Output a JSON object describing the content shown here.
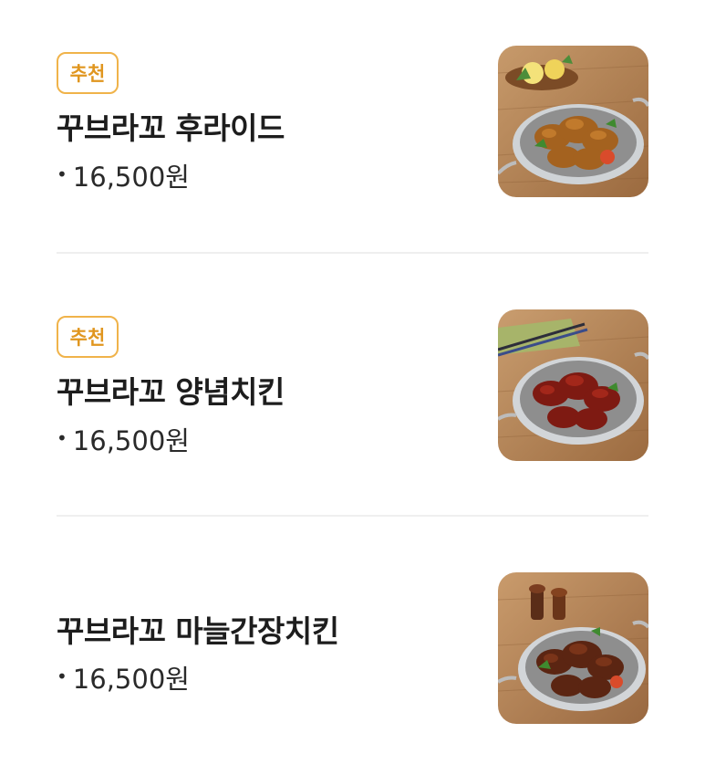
{
  "menu": {
    "items": [
      {
        "badge": "추천",
        "name": "꾸브라꼬 후라이드",
        "bullet": "•",
        "price": "16,500원",
        "image_icon": "fried-chicken-photo"
      },
      {
        "badge": "추천",
        "name": "꾸브라꼬 양념치킨",
        "bullet": "•",
        "price": "16,500원",
        "image_icon": "seasoned-chicken-photo"
      },
      {
        "name": "꾸브라꼬 마늘간장치킨",
        "bullet": "•",
        "price": "16,500원",
        "image_icon": "garlic-soy-chicken-photo"
      }
    ]
  },
  "colors": {
    "badge_border": "#f0b34a",
    "badge_text": "#e0961f",
    "divider": "#efefef",
    "text": "#1d1d1d"
  }
}
